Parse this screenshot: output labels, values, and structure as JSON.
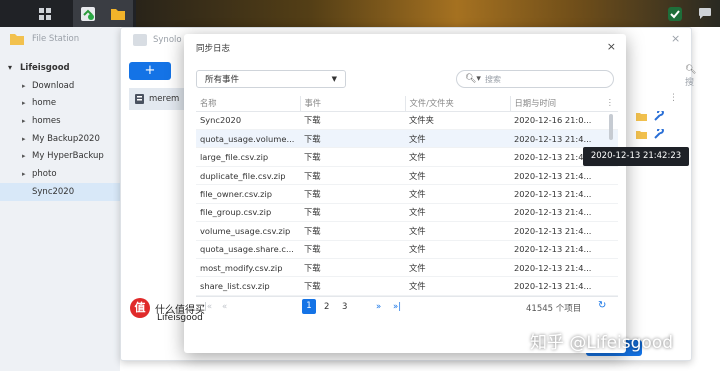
{
  "file_station": {
    "title": "File Station",
    "root": "Lifeisgood",
    "tree": [
      "Download",
      "home",
      "homes",
      "My Backup2020",
      "My HyperBackup",
      "photo",
      "Sync2020"
    ]
  },
  "window2": {
    "title": "Synolo",
    "plus_label": "+",
    "item_label": "merem",
    "search_placeholder": "搜"
  },
  "tooltip": "2020-12-13 21:42:23",
  "dialog": {
    "title": "同步日志",
    "close": "×",
    "filter_value": "所有事件",
    "search_placeholder": "搜索",
    "columns": [
      "名称",
      "事件",
      "文件/文件夹",
      "日期与时间"
    ],
    "rows": [
      {
        "name": "Sync2020",
        "event": "下载",
        "type": "文件夹",
        "date": "2020-12-16 21:0..."
      },
      {
        "name": "quota_usage.volume...",
        "event": "下载",
        "type": "文件",
        "date": "2020-12-13 21:4..."
      },
      {
        "name": "large_file.csv.zip",
        "event": "下载",
        "type": "文件",
        "date": "2020-12-13 21:4..."
      },
      {
        "name": "duplicate_file.csv.zip",
        "event": "下载",
        "type": "文件",
        "date": "2020-12-13 21:4..."
      },
      {
        "name": "file_owner.csv.zip",
        "event": "下载",
        "type": "文件",
        "date": "2020-12-13 21:4..."
      },
      {
        "name": "file_group.csv.zip",
        "event": "下载",
        "type": "文件",
        "date": "2020-12-13 21:4..."
      },
      {
        "name": "volume_usage.csv.zip",
        "event": "下载",
        "type": "文件",
        "date": "2020-12-13 21:4..."
      },
      {
        "name": "quota_usage.share.c...",
        "event": "下载",
        "type": "文件",
        "date": "2020-12-13 21:4..."
      },
      {
        "name": "most_modify.csv.zip",
        "event": "下载",
        "type": "文件",
        "date": "2020-12-13 21:4..."
      },
      {
        "name": "share_list.csv.zip",
        "event": "下载",
        "type": "文件",
        "date": "2020-12-13 21:4..."
      }
    ],
    "pager": {
      "pages": [
        "1",
        "2",
        "3"
      ],
      "current": "1",
      "total": "41545 个项目"
    }
  },
  "watermark": {
    "logo_char": "值",
    "brand": "什么值得买",
    "user": "Lifeisgood",
    "zhihu": "知乎 @Lifeisgood"
  },
  "colors": {
    "accent": "#1473e6",
    "taskbar": "#202226"
  }
}
